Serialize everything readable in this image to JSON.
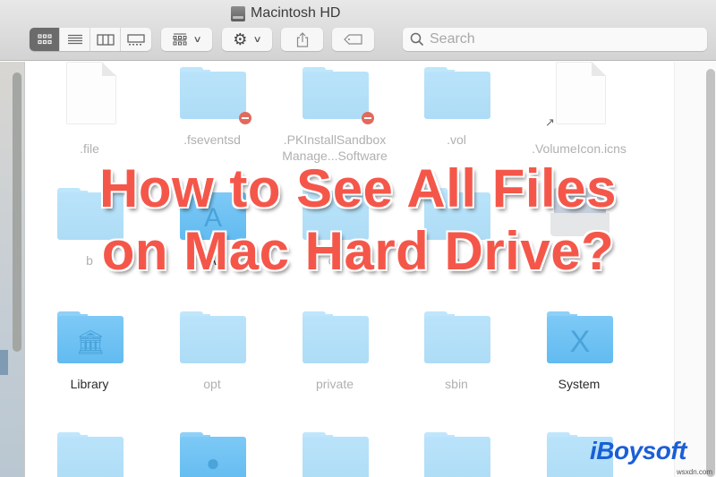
{
  "window": {
    "title": "Macintosh HD"
  },
  "toolbar": {
    "view_modes": [
      {
        "name": "icon-view",
        "active": true
      },
      {
        "name": "list-view",
        "active": false
      },
      {
        "name": "column-view",
        "active": false
      },
      {
        "name": "gallery-view",
        "active": false
      }
    ],
    "group_button": "group-by",
    "action_button": "action",
    "share_button": "share",
    "tag_button": "tags",
    "search": {
      "placeholder": "Search",
      "value": ""
    }
  },
  "files": {
    "row1": [
      {
        "name": ".file",
        "type": "document",
        "hidden": true
      },
      {
        "name": ".fseventsd",
        "type": "folder",
        "hidden": true,
        "restricted": true
      },
      {
        "name": ".PKInstallSandbox Manage...Software",
        "type": "folder",
        "hidden": true,
        "restricted": true
      },
      {
        "name": ".vol",
        "type": "folder",
        "hidden": true
      },
      {
        "name": ".VolumeIcon.icns",
        "type": "alias-document",
        "hidden": true
      }
    ],
    "row2": [
      {
        "name": "b",
        "type": "folder",
        "hidden": true
      },
      {
        "name": "A",
        "type": "applications-folder",
        "hidden": false
      },
      {
        "name": "co",
        "type": "folder",
        "hidden": true
      },
      {
        "name": "e",
        "type": "folder",
        "hidden": true
      },
      {
        "name": "",
        "type": "drive-alias",
        "hidden": true
      }
    ],
    "row3": [
      {
        "name": "Library",
        "type": "library-folder",
        "hidden": false
      },
      {
        "name": "opt",
        "type": "folder",
        "hidden": true
      },
      {
        "name": "private",
        "type": "folder",
        "hidden": true
      },
      {
        "name": "sbin",
        "type": "folder",
        "hidden": true
      },
      {
        "name": "System",
        "type": "system-folder",
        "hidden": false
      }
    ],
    "row4": [
      {
        "name": "",
        "type": "folder",
        "hidden": true
      },
      {
        "name": "",
        "type": "users-folder",
        "hidden": false
      },
      {
        "name": "",
        "type": "folder",
        "hidden": true
      },
      {
        "name": "",
        "type": "folder",
        "hidden": true
      },
      {
        "name": "",
        "type": "folder",
        "hidden": true
      }
    ]
  },
  "overlay": {
    "headline_line1": "How to See All Files",
    "headline_line2": "on Mac Hard Drive?",
    "headline_color": "#f4574a",
    "brand": "iBoysoft",
    "brand_color": "#1b5fd6",
    "watermark": "wsxdn.com"
  }
}
